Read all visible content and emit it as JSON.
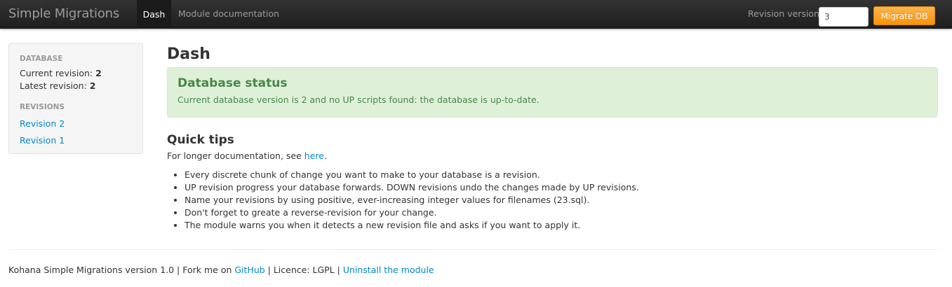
{
  "navbar": {
    "brand": "Simple Migrations",
    "items": [
      {
        "label": "Dash",
        "active": true
      },
      {
        "label": "Module documentation",
        "active": false
      }
    ],
    "revision_label": "Revision version:",
    "revision_value": "3",
    "migrate_button": "Migrate DB",
    "accent_color": "#f89406"
  },
  "sidebar": {
    "database_header": "DATABASE",
    "current_revision_label": "Current revision:",
    "current_revision_value": "2",
    "latest_revision_label": "Latest revision:",
    "latest_revision_value": "2",
    "revisions_header": "REVISIONS",
    "revisions": [
      "Revision 2",
      "Revision 1"
    ]
  },
  "main": {
    "title": "Dash",
    "status": {
      "title": "Database status",
      "message": "Current database version is 2 and no UP scripts found: the database is up-to-date.",
      "color": "#468847",
      "background": "#dff0d8"
    },
    "tips": {
      "title": "Quick tips",
      "intro_prefix": "For longer documentation, see ",
      "intro_link": "here",
      "intro_suffix": ".",
      "items": [
        "Every discrete chunk of change you want to make to your database is a revision.",
        "UP revision progress your database forwards. DOWN revisions undo the changes made by UP revisions.",
        "Name your revisions by using positive, ever-increasing integer values for filenames (23.sql).",
        "Don't forget to greate a reverse-revision for your change.",
        "The module warns you when it detects a new revision file and asks if you want to apply it."
      ]
    }
  },
  "footer": {
    "version_text": "Kohana Simple Migrations version 1.0 | Fork me on ",
    "github_link": "GitHub",
    "licence_text": " | Licence: LGPL | ",
    "uninstall_link": "Uninstall the module"
  }
}
